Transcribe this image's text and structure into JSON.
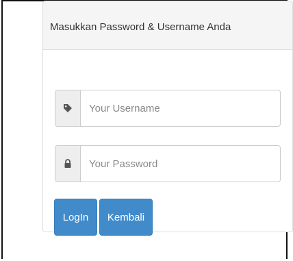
{
  "panel": {
    "title": "Masukkan Password & Username Anda"
  },
  "form": {
    "username": {
      "icon": "tag-icon",
      "placeholder": "Your Username",
      "value": ""
    },
    "password": {
      "icon": "lock-icon",
      "placeholder": "Your Password",
      "value": ""
    }
  },
  "buttons": {
    "login_label": "LogIn",
    "back_label": "Kembali"
  },
  "colors": {
    "primary": "#428bca",
    "heading_bg": "#f5f5f5",
    "addon_bg": "#eeeeee",
    "border": "#cccccc"
  }
}
